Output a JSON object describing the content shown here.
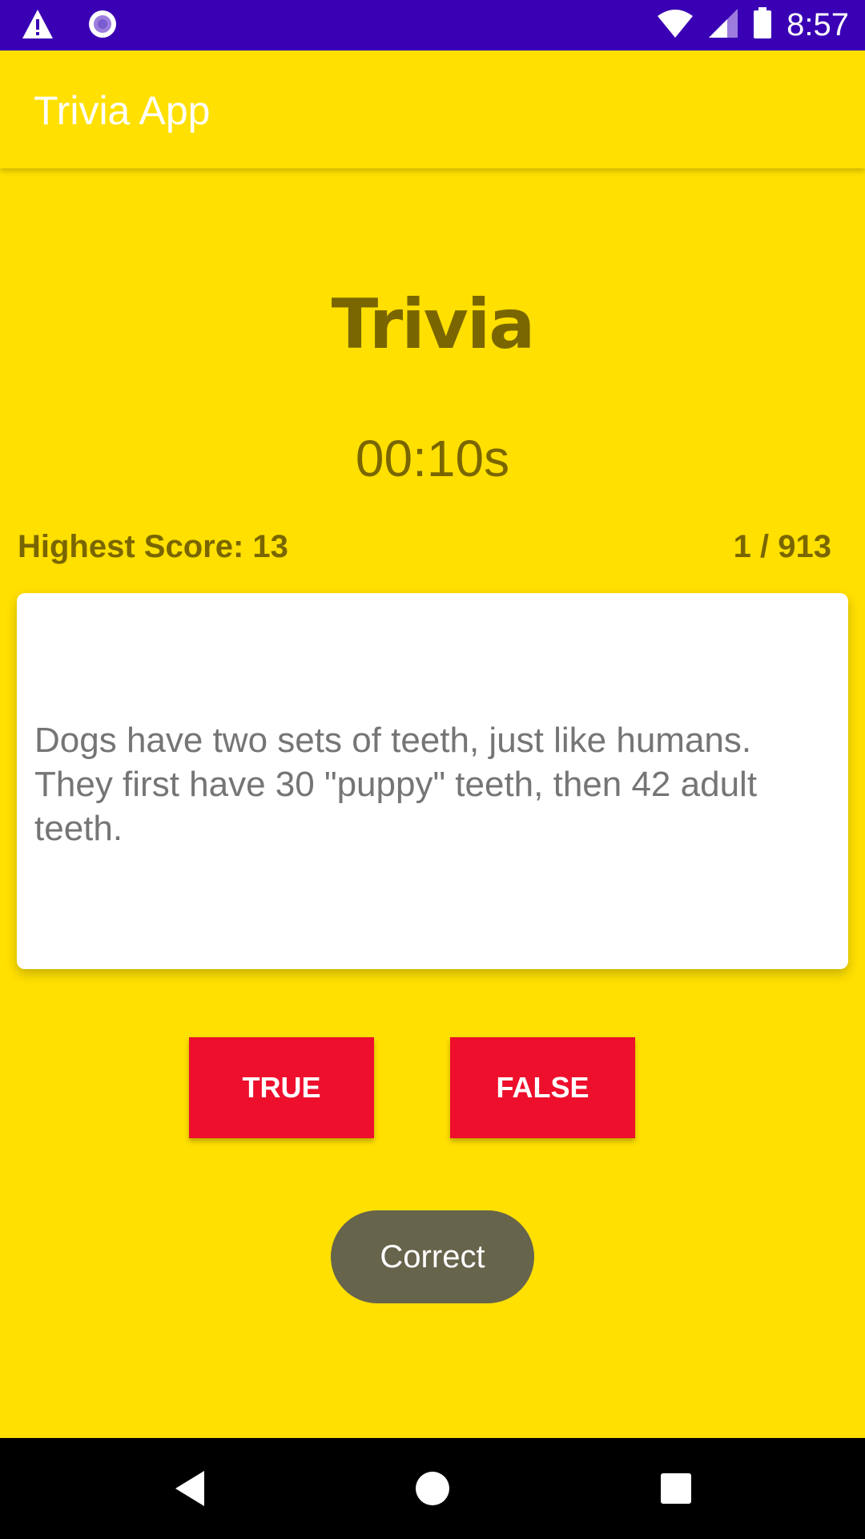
{
  "status_bar": {
    "time": "8:57",
    "icons": [
      "warning-icon",
      "record-icon",
      "wifi-icon",
      "signal-icon",
      "battery-icon"
    ],
    "background": "#3A00B4"
  },
  "app_bar": {
    "title": "Trivia App",
    "background": "#FFE000"
  },
  "main": {
    "heading": "Trivia",
    "timer": "00:10s",
    "highest_score": "Highest Score: 13",
    "question_counter": "1 / 913",
    "question_text": "Dogs have two sets of teeth, just like humans. They first have 30 \"puppy\" teeth, then 42 adult teeth.",
    "true_label": "TRUE",
    "false_label": "FALSE",
    "button_color": "#EE0F2C",
    "text_color": "#7A6600"
  },
  "toast": {
    "message": "Correct"
  },
  "nav_bar": {
    "icons": [
      "back-icon",
      "home-icon",
      "recents-icon"
    ]
  }
}
